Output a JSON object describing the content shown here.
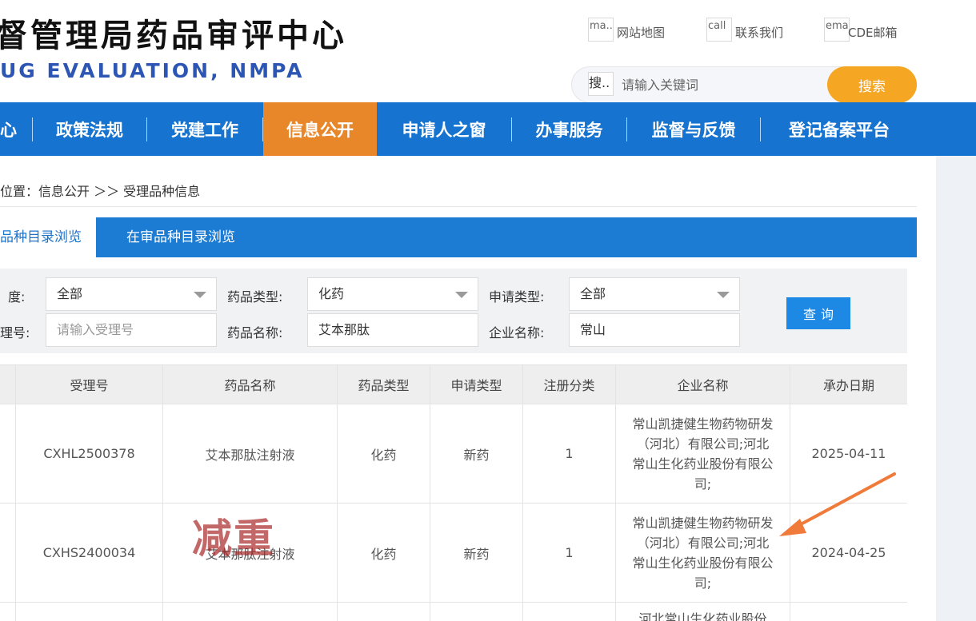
{
  "header": {
    "title_cn": "督管理局药品审评中心",
    "title_en": "UG EVALUATION, NMPA",
    "links": [
      {
        "icon_alt": "ma..",
        "label": "网站地图"
      },
      {
        "icon_alt": "call",
        "label": "联系我们"
      },
      {
        "icon_alt": "ema..",
        "label": "CDE邮箱"
      }
    ],
    "search": {
      "icon_alt": "搜..",
      "placeholder": "请输入关键词",
      "button": "搜索"
    }
  },
  "nav": {
    "items": [
      "心",
      "政策法规",
      "党建工作",
      "信息公开",
      "申请人之窗",
      "办事服务",
      "监督与反馈",
      "登记备案平台"
    ],
    "active": "信息公开"
  },
  "breadcrumb": "位置：信息公开 ＞＞ 受理品种信息",
  "tabs": [
    "品种目录浏览",
    "在审品种目录浏览"
  ],
  "filters": {
    "year_label": "度:",
    "year_value": "全部",
    "drug_type_label": "药品类型:",
    "drug_type_value": "化药",
    "apply_type_label": "申请类型:",
    "apply_type_value": "全部",
    "accept_no_label": "理号:",
    "accept_no_placeholder": "请输入受理号",
    "drug_name_label": "药品名称:",
    "drug_name_value": "艾本那肽",
    "company_label": "企业名称:",
    "company_value": "常山",
    "query_button": "查询"
  },
  "table": {
    "headers": [
      "受理号",
      "药品名称",
      "药品类型",
      "申请类型",
      "注册分类",
      "企业名称",
      "承办日期"
    ],
    "rows": [
      {
        "accept_no": "CXHL2500378",
        "drug_name": "艾本那肽注射液",
        "drug_type": "化药",
        "apply_type": "新药",
        "reg_class": "1",
        "company": "常山凯捷健生物药物研发（河北）有限公司;河北常山生化药业股份有限公司;",
        "date": "2025-04-11"
      },
      {
        "accept_no": "CXHS2400034",
        "drug_name": "艾本那肽注射液",
        "drug_type": "化药",
        "apply_type": "新药",
        "reg_class": "1",
        "company": "常山凯捷健生物药物研发（河北）有限公司;河北常山生化药业股份有限公司;",
        "date": "2024-04-25"
      },
      {
        "company": "河北常山生化药业股份"
      }
    ]
  },
  "annotations": {
    "stamp_text": "减重",
    "arrow_color": "#f07a3a"
  },
  "colors": {
    "nav_bg": "#1673cf",
    "nav_active": "#e8862a",
    "search_btn": "#f5a623",
    "query_btn": "#1e88e5"
  }
}
